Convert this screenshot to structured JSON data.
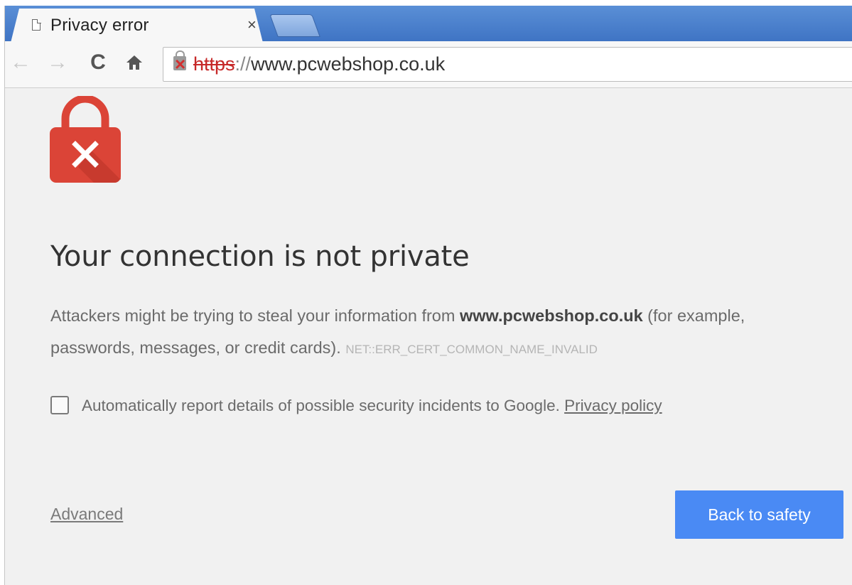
{
  "browser": {
    "tab": {
      "title": "Privacy error",
      "close_glyph": "×"
    },
    "toolbar": {
      "back_icon": "back-arrow-icon",
      "forward_icon": "forward-arrow-icon",
      "reload_icon": "reload-icon",
      "home_icon": "home-icon"
    },
    "address_bar": {
      "scheme": "https",
      "separator": "://",
      "host": "www.pcwebshop.co.uk",
      "security_state": "not-secure"
    }
  },
  "page": {
    "heading": "Your connection is not private",
    "explanation": {
      "before": "Attackers might be trying to steal your information from ",
      "domain": "www.pcwebshop.co.uk",
      "after": " (for example, passwords, messages, or credit cards). ",
      "error_code": "NET::ERR_CERT_COMMON_NAME_INVALID"
    },
    "report": {
      "checked": false,
      "label": "Automatically report details of possible security incidents to Google. ",
      "privacy_link": "Privacy policy"
    },
    "advanced_link": "Advanced",
    "back_button": "Back to safety"
  },
  "colors": {
    "error_red": "#db4437",
    "primary_blue": "#4a8af4",
    "page_background": "#f1f1f1"
  }
}
